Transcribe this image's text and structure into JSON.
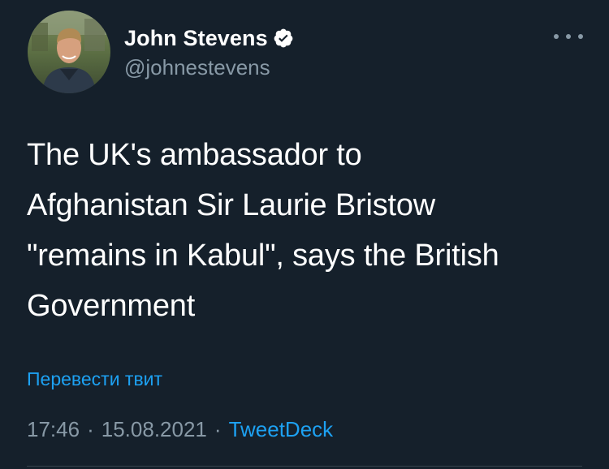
{
  "tweet": {
    "author": {
      "display_name": "John Stevens",
      "handle": "@johnestevens",
      "verified": true
    },
    "text_lines": [
      "The UK's ambassador to",
      "Afghanistan Sir Laurie Bristow",
      "\"remains in Kabul\", says the British",
      "Government"
    ],
    "translate_label": "Перевести твит",
    "time": "17:46",
    "separator": "·",
    "date": "15.08.2021",
    "source": "TweetDeck"
  },
  "colors": {
    "background": "#15202b",
    "accent": "#1da1f2",
    "secondary_text": "#8899a6",
    "primary_text": "#ffffff"
  },
  "icons": {
    "verified": "verified-badge-icon",
    "more": "more-options-icon"
  }
}
